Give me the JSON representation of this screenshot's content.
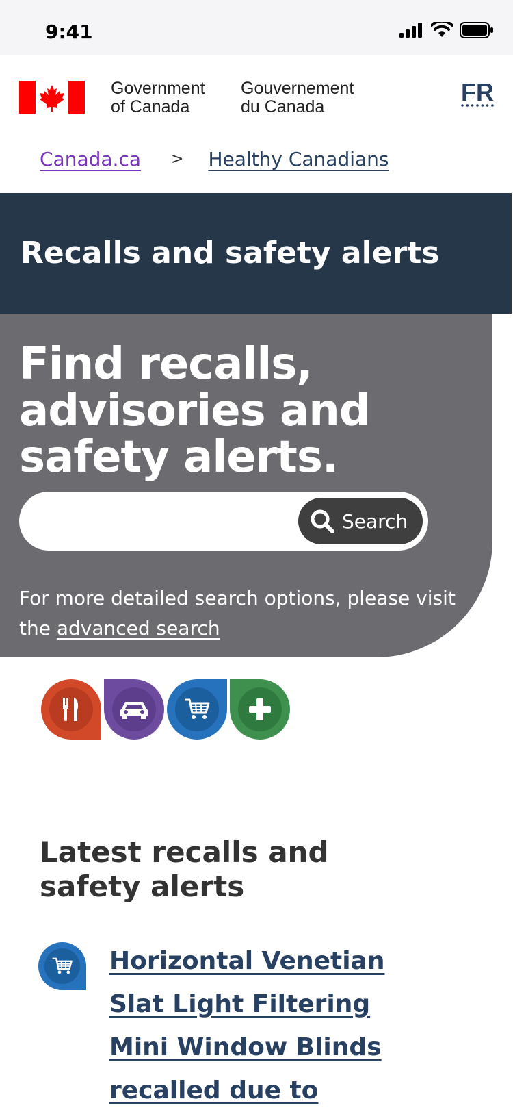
{
  "status_bar": {
    "time": "9:41"
  },
  "header": {
    "gov_name_en_line1": "Government",
    "gov_name_en_line2": "of Canada",
    "gov_name_fr_line1": "Gouvernement",
    "gov_name_fr_line2": "du Canada",
    "language_toggle": "FR",
    "flag_color": "#ff0000"
  },
  "breadcrumb": {
    "items": [
      "Canada.ca",
      "Healthy Canadians"
    ],
    "separator": ">"
  },
  "banner": {
    "title": "Recalls and safety alerts",
    "background": "#26374a"
  },
  "hero": {
    "heading": "Find recalls, advisories and safety alerts.",
    "search": {
      "placeholder": "",
      "value": "",
      "button_label": "Search"
    },
    "note_prefix": "For more detailed search options, please visit the ",
    "note_link": "advanced search"
  },
  "categories": [
    {
      "icon": "fork-knife-icon",
      "color": "#d2492a"
    },
    {
      "icon": "car-icon",
      "color": "#6d4c9f"
    },
    {
      "icon": "shopping-cart-icon",
      "color": "#2672bd"
    },
    {
      "icon": "plus-icon",
      "color": "#3f8f4f"
    }
  ],
  "latest": {
    "heading": "Latest recalls and safety alerts",
    "items": [
      {
        "icon": "shopping-cart-icon",
        "title": "Horizontal Venetian Slat Light Filtering Mini Window Blinds recalled due to"
      }
    ]
  }
}
